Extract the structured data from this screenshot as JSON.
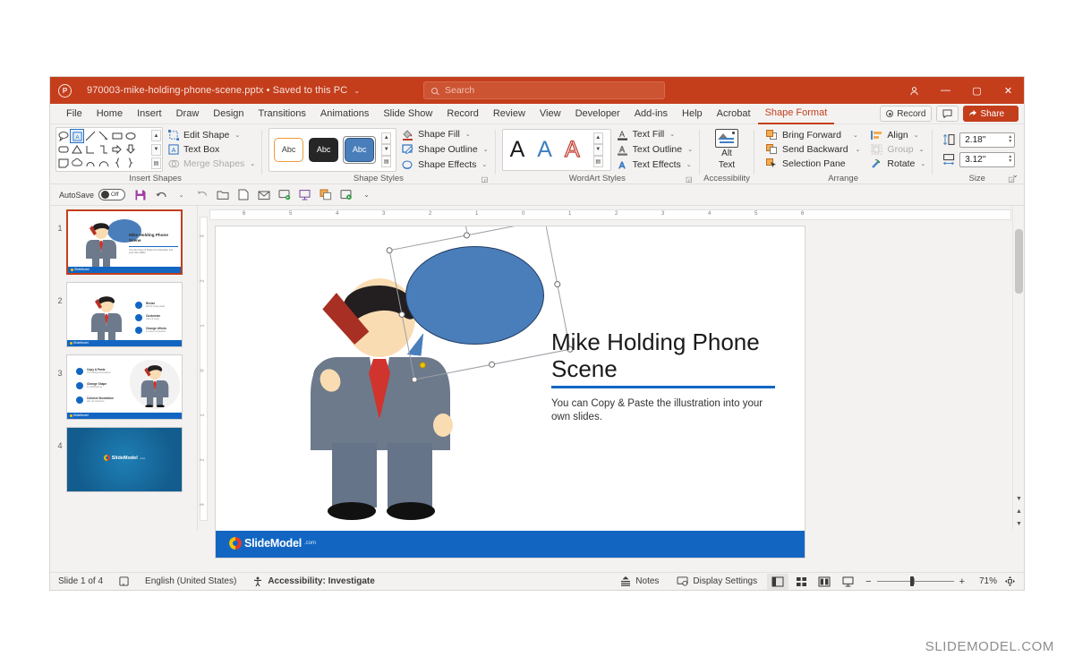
{
  "window": {
    "title_file": "970003-mike-holding-phone-scene.pptx",
    "title_saved": "Saved to this PC",
    "title_separator": "•",
    "title_chevron": "⌄",
    "app_icon": "powerpoint-logo-icon",
    "minimize": "—",
    "maximize": "▢",
    "close": "✕",
    "comments_icon": "comment-icon",
    "search": {
      "placeholder": "Search",
      "icon": "search-icon"
    }
  },
  "ribbon_tabs": [
    {
      "label": "File",
      "active": false
    },
    {
      "label": "Home",
      "active": false
    },
    {
      "label": "Insert",
      "active": false
    },
    {
      "label": "Draw",
      "active": false
    },
    {
      "label": "Design",
      "active": false
    },
    {
      "label": "Transitions",
      "active": false
    },
    {
      "label": "Animations",
      "active": false
    },
    {
      "label": "Slide Show",
      "active": false
    },
    {
      "label": "Record",
      "active": false
    },
    {
      "label": "Review",
      "active": false
    },
    {
      "label": "View",
      "active": false
    },
    {
      "label": "Developer",
      "active": false
    },
    {
      "label": "Add-ins",
      "active": false
    },
    {
      "label": "Help",
      "active": false
    },
    {
      "label": "Acrobat",
      "active": false
    },
    {
      "label": "Shape Format",
      "active": true
    }
  ],
  "tabbar_right": {
    "record_label": "Record",
    "share_label": "Share",
    "share_caret": "⌄",
    "comments_icon": "comment-icon"
  },
  "ribbon": {
    "insert_shapes": {
      "group_label": "Insert Shapes",
      "menu": [
        {
          "label": "Edit Shape",
          "icon": "edit-shape-icon",
          "caret": "⌄",
          "disabled": false
        },
        {
          "label": "Text Box",
          "icon": "text-box-icon",
          "caret": "",
          "disabled": false
        },
        {
          "label": "Merge Shapes",
          "icon": "merge-shapes-icon",
          "caret": "⌄",
          "disabled": true
        }
      ]
    },
    "shape_styles": {
      "group_label": "Shape Styles",
      "thumb_label": "Abc",
      "menu": [
        {
          "label": "Shape Fill",
          "icon": "shape-fill-icon",
          "caret": "⌄"
        },
        {
          "label": "Shape Outline",
          "icon": "shape-outline-icon",
          "caret": "⌄"
        },
        {
          "label": "Shape Effects",
          "icon": "shape-effects-icon",
          "caret": "⌄"
        }
      ],
      "dialog_launcher": "◲"
    },
    "wordart_styles": {
      "group_label": "WordArt Styles",
      "sample_glyph": "A",
      "menu": [
        {
          "label": "Text Fill",
          "icon": "text-fill-icon",
          "caret": "⌄"
        },
        {
          "label": "Text Outline",
          "icon": "text-outline-icon",
          "caret": "⌄"
        },
        {
          "label": "Text Effects",
          "icon": "text-effects-icon",
          "caret": "⌄"
        }
      ],
      "dialog_launcher": "◲"
    },
    "accessibility": {
      "group_label": "Accessibility",
      "alt_text_line1": "Alt",
      "alt_text_line2": "Text",
      "icon": "alt-text-picture-icon"
    },
    "arrange": {
      "group_label": "Arrange",
      "left_items": [
        {
          "label": "Bring Forward",
          "icon": "bring-forward-icon",
          "caret": "⌄",
          "disabled": false
        },
        {
          "label": "Send Backward",
          "icon": "send-backward-icon",
          "caret": "⌄",
          "disabled": false
        },
        {
          "label": "Selection Pane",
          "icon": "selection-pane-icon",
          "caret": "",
          "disabled": false
        }
      ],
      "right_items": [
        {
          "label": "Align",
          "icon": "align-icon",
          "caret": "⌄",
          "disabled": false
        },
        {
          "label": "Group",
          "icon": "group-icon",
          "caret": "⌄",
          "disabled": true
        },
        {
          "label": "Rotate",
          "icon": "rotate-icon",
          "caret": "⌄",
          "disabled": false
        }
      ]
    },
    "size": {
      "group_label": "Size",
      "height_value": "2.18\"",
      "width_value": "3.12\"",
      "height_icon": "shape-height-icon",
      "width_icon": "shape-width-icon",
      "dialog_launcher": "◲"
    },
    "collapse_icon": "⌄"
  },
  "quick_access": {
    "autosave_label": "AutoSave",
    "autosave_state": "Off",
    "buttons": [
      {
        "name": "save-icon"
      },
      {
        "name": "undo-icon"
      },
      {
        "name": "undo-dropdown-caret"
      },
      {
        "name": "redo-icon"
      },
      {
        "name": "open-icon"
      },
      {
        "name": "new-slide-icon"
      },
      {
        "name": "email-icon"
      },
      {
        "name": "start-from-beginning-icon"
      },
      {
        "name": "present-icon"
      },
      {
        "name": "duplicate-icon"
      },
      {
        "name": "present-online-icon"
      },
      {
        "name": "customize-quick-access-toolbar-caret"
      }
    ]
  },
  "thumbnails": [
    {
      "number": "1",
      "selected": true,
      "title": "Mike Holding Phone Scene",
      "subtitle": "You can Copy & Paste the illustration into your own slides."
    },
    {
      "number": "2",
      "selected": false,
      "bullets": [
        {
          "title": "Resize",
          "desc": "without losing quality"
        },
        {
          "title": "Customize",
          "desc": "colors & styles"
        },
        {
          "title": "Change effects",
          "desc": "to deeper perspective"
        }
      ]
    },
    {
      "number": "3",
      "selected": false,
      "bullets": [
        {
          "title": "Copy & Paste",
          "desc": "into existing presentations"
        },
        {
          "title": "Change Shape",
          "desc": "for individual use"
        },
        {
          "title": "Colorize Illustration",
          "desc": "with soft transitions"
        }
      ]
    },
    {
      "number": "4",
      "selected": false,
      "brand": "SlideModel",
      "brand_suffix": ".com"
    }
  ],
  "rulers": {
    "horizontal_ticks": [
      "6",
      "5",
      "4",
      "3",
      "2",
      "1",
      "0",
      "1",
      "2",
      "3",
      "4",
      "5",
      "6"
    ],
    "vertical_ticks": [
      "3",
      "2",
      "1",
      "0",
      "1",
      "2",
      "3"
    ]
  },
  "slide": {
    "title": "Mike Holding Phone Scene",
    "body": "You can Copy & Paste the illustration into your own slides.",
    "footer_brand": "SlideModel",
    "footer_brand_suffix": ".com",
    "selected_shape": "speech-bubble-shape",
    "accent_color": "#1266c2",
    "bubble_color": "#4a7ebb"
  },
  "status_bar": {
    "slide_counter": "Slide 1 of 4",
    "slide_notes_icon": "slide-notes-icon",
    "language": "English (United States)",
    "accessibility": "Accessibility: Investigate",
    "accessibility_icon": "accessibility-icon",
    "notes_label": "Notes",
    "notes_icon": "notes-icon",
    "display_settings_label": "Display Settings",
    "display_settings_icon": "display-settings-icon",
    "views": [
      {
        "name": "normal-view-button",
        "active": true
      },
      {
        "name": "slide-sorter-view-button",
        "active": false
      },
      {
        "name": "reading-view-button",
        "active": false
      },
      {
        "name": "slide-show-view-button",
        "active": false
      }
    ],
    "zoom_out": "−",
    "zoom_in": "+",
    "zoom_level": "71%",
    "fit_to_window_icon": "fit-slide-to-window-icon"
  },
  "page_watermark": "SLIDEMODEL.COM"
}
